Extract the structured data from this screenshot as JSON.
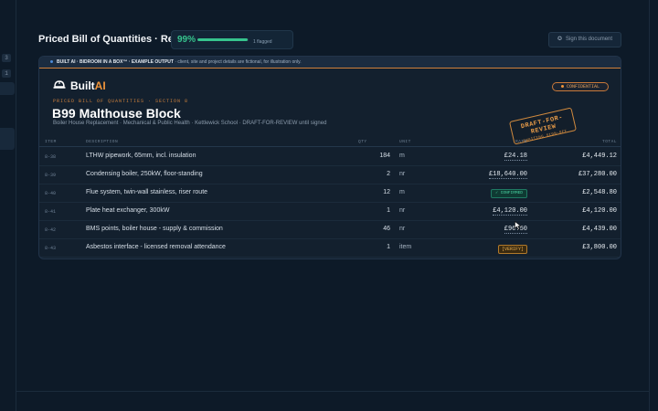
{
  "header": {
    "title": "Priced Bill of Quantities · Rev 1",
    "progress_pct_label": "99%",
    "progress_value": 0.99,
    "flagged_label": "1 flagged",
    "sign_button_label": "Sign this document",
    "sign_icon": "seal-icon"
  },
  "rail": {
    "badges": [
      "3",
      "1"
    ]
  },
  "banner": {
    "lead": "BUILT AI · BIDROOM IN A BOX™ · EXAMPLE OUTPUT",
    "note": " · client, site and project details are fictional, for illustration only."
  },
  "brand": {
    "name_main": "Built",
    "name_accent": "AI",
    "logo_icon": "hardhat-logo-icon"
  },
  "badge": {
    "confidential": "CONFIDENTIAL"
  },
  "document": {
    "kicker": "PRICED BILL OF QUANTITIES · SECTION 8",
    "title": "B99 Malthouse Block",
    "subtitle": "Boiler House Replacement · Mechanical & Public Health · Kettlewick School · DRAFT-FOR-REVIEW until signed"
  },
  "stamp": {
    "main": "DRAFT-FOR-REVIEW",
    "sub": "AWAITING SIGN-OFF"
  },
  "table": {
    "headers": {
      "item": "ITEM",
      "description": "DESCRIPTION",
      "qty": "QTY",
      "unit": "UNIT",
      "rate": "RATE",
      "total": "TOTAL"
    },
    "rows": [
      {
        "item": "8-38",
        "description": "LTHW pipework, 65mm, incl. insulation",
        "qty": "184",
        "unit": "m",
        "rate": "£24.18",
        "status": "",
        "total": "£4,449.12"
      },
      {
        "item": "8-39",
        "description": "Condensing boiler, 250kW, floor-standing",
        "qty": "2",
        "unit": "nr",
        "rate": "£18,640.00",
        "status": "",
        "total": "£37,280.00"
      },
      {
        "item": "8-40",
        "description": "Flue system, twin-wall stainless, riser route",
        "qty": "12",
        "unit": "m",
        "rate": "",
        "status": "✓ CONFIRMED",
        "total": "£2,548.80"
      },
      {
        "item": "8-41",
        "description": "Plate heat exchanger, 300kW",
        "qty": "1",
        "unit": "nr",
        "rate": "£4,120.00",
        "status": "",
        "total": "£4,120.00"
      },
      {
        "item": "8-42",
        "description": "BMS points, boiler house - supply & commission",
        "qty": "46",
        "unit": "nr",
        "rate": "£96.50",
        "status": "",
        "total": "£4,439.00"
      },
      {
        "item": "8-43",
        "description": "Asbestos interface - licensed removal attendance",
        "qty": "1",
        "unit": "item",
        "rate": "",
        "status": "[VERIFY]",
        "total": "£3,800.00"
      }
    ]
  },
  "colors": {
    "accent_orange": "#f0953a",
    "success_green": "#36c48d",
    "background": "#0d1a28"
  }
}
